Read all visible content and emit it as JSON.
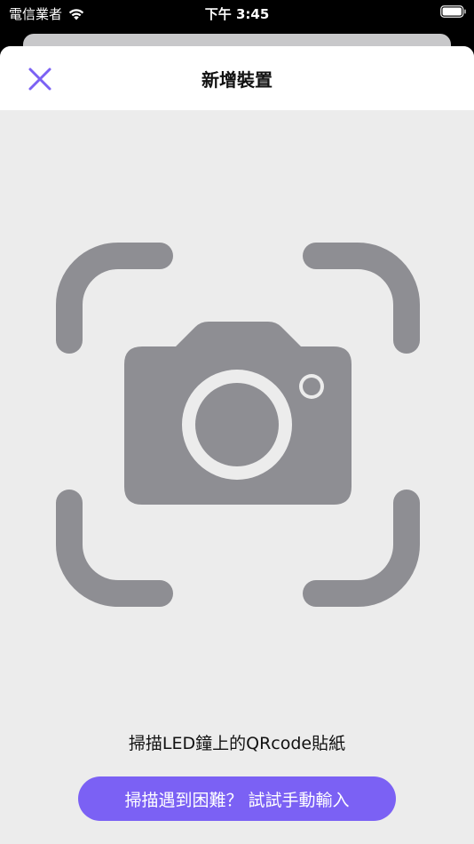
{
  "status_bar": {
    "carrier": "電信業者",
    "time": "下午 3:45",
    "wifi_icon": "wifi-icon",
    "battery_icon": "battery-icon"
  },
  "nav": {
    "title": "新增裝置",
    "close_icon": "close-icon"
  },
  "scanner": {
    "frame_icon": "camera-scan-frame-icon",
    "instruction": "掃描LED鐘上的QRcode貼紙"
  },
  "manual_button": {
    "label": "掃描遇到困難？ 試試手動輸入"
  },
  "colors": {
    "accent": "#7b61f4",
    "icon_gray": "#8e8e93",
    "sheet_background": "#ececec"
  }
}
